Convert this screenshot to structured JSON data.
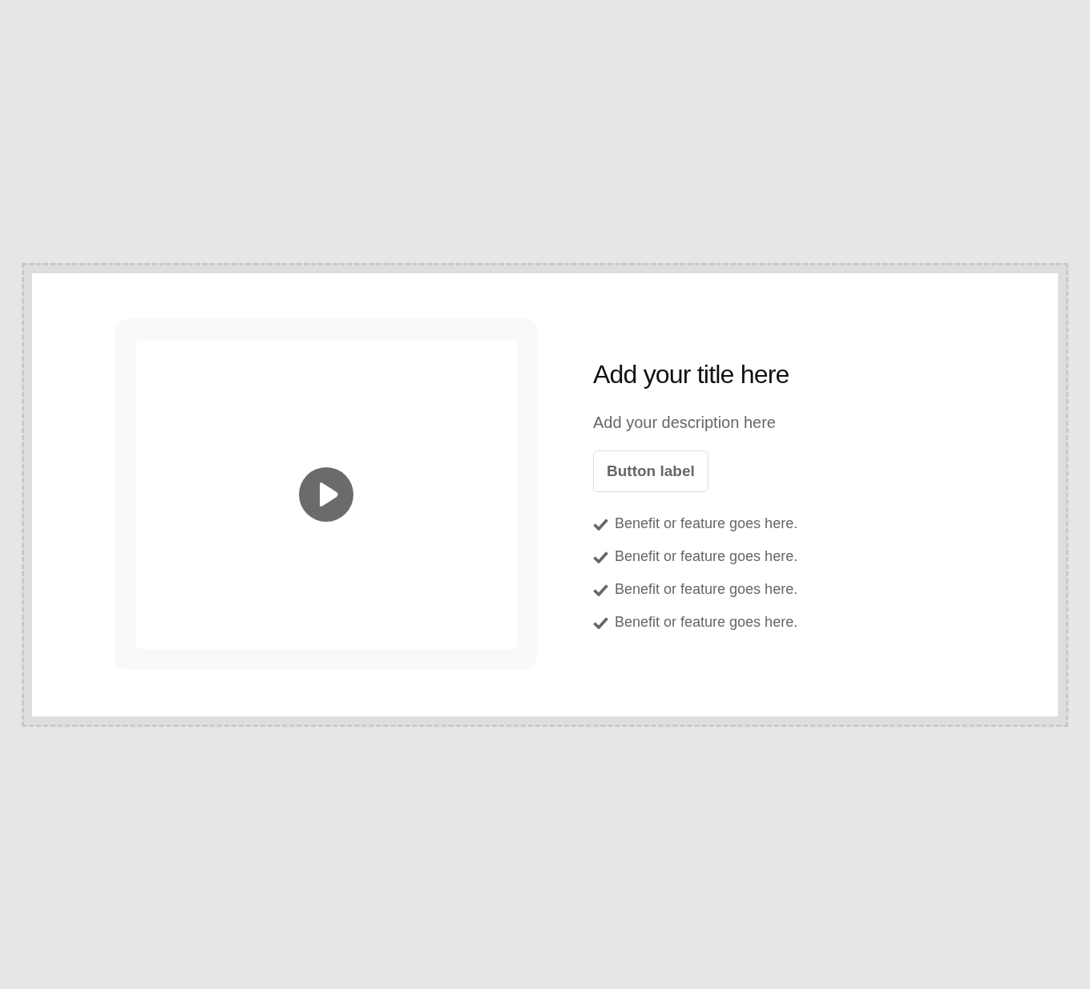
{
  "title": "Add your title here",
  "description": "Add your description here",
  "button": "Button label",
  "benefits": [
    "Benefit or feature goes here.",
    "Benefit or feature goes here.",
    "Benefit or feature goes here.",
    "Benefit or feature goes here."
  ]
}
